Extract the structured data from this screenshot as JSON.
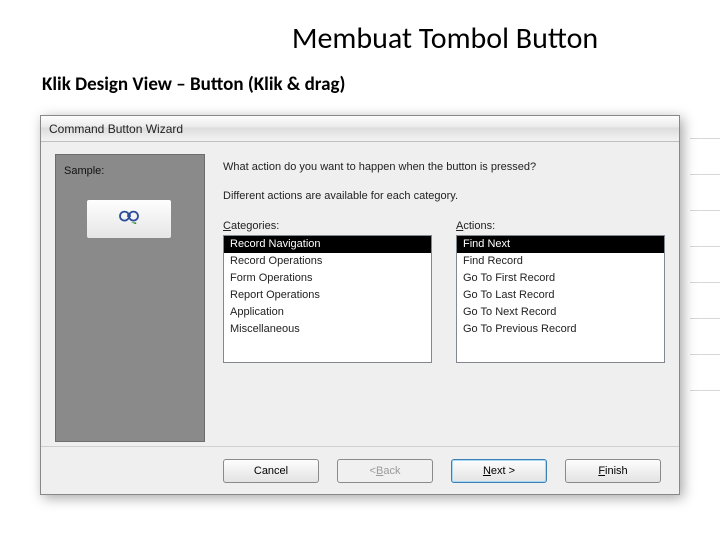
{
  "slide": {
    "title": "Membuat Tombol Button",
    "subtitle": "Klik Design View – Button (Klik & drag)"
  },
  "dialog": {
    "title": "Command Button Wizard",
    "sample_label": "Sample:",
    "question1": "What action do you want to happen when the button is pressed?",
    "question2": "Different actions are available for each category.",
    "categories_label_pre": "C",
    "categories_label_rest": "ategories:",
    "actions_label_pre": "A",
    "actions_label_rest": "ctions:",
    "categories": [
      "Record Navigation",
      "Record Operations",
      "Form Operations",
      "Report Operations",
      "Application",
      "Miscellaneous"
    ],
    "actions": [
      "Find Next",
      "Find Record",
      "Go To First Record",
      "Go To Last Record",
      "Go To Next Record",
      "Go To Previous Record"
    ],
    "selected_category_index": 0,
    "selected_action_index": 0,
    "buttons": {
      "cancel": "Cancel",
      "back_pre": "< ",
      "back_ul": "B",
      "back_rest": "ack",
      "next_ul": "N",
      "next_rest": "ext >",
      "finish_ul": "F",
      "finish_rest": "inish"
    }
  }
}
